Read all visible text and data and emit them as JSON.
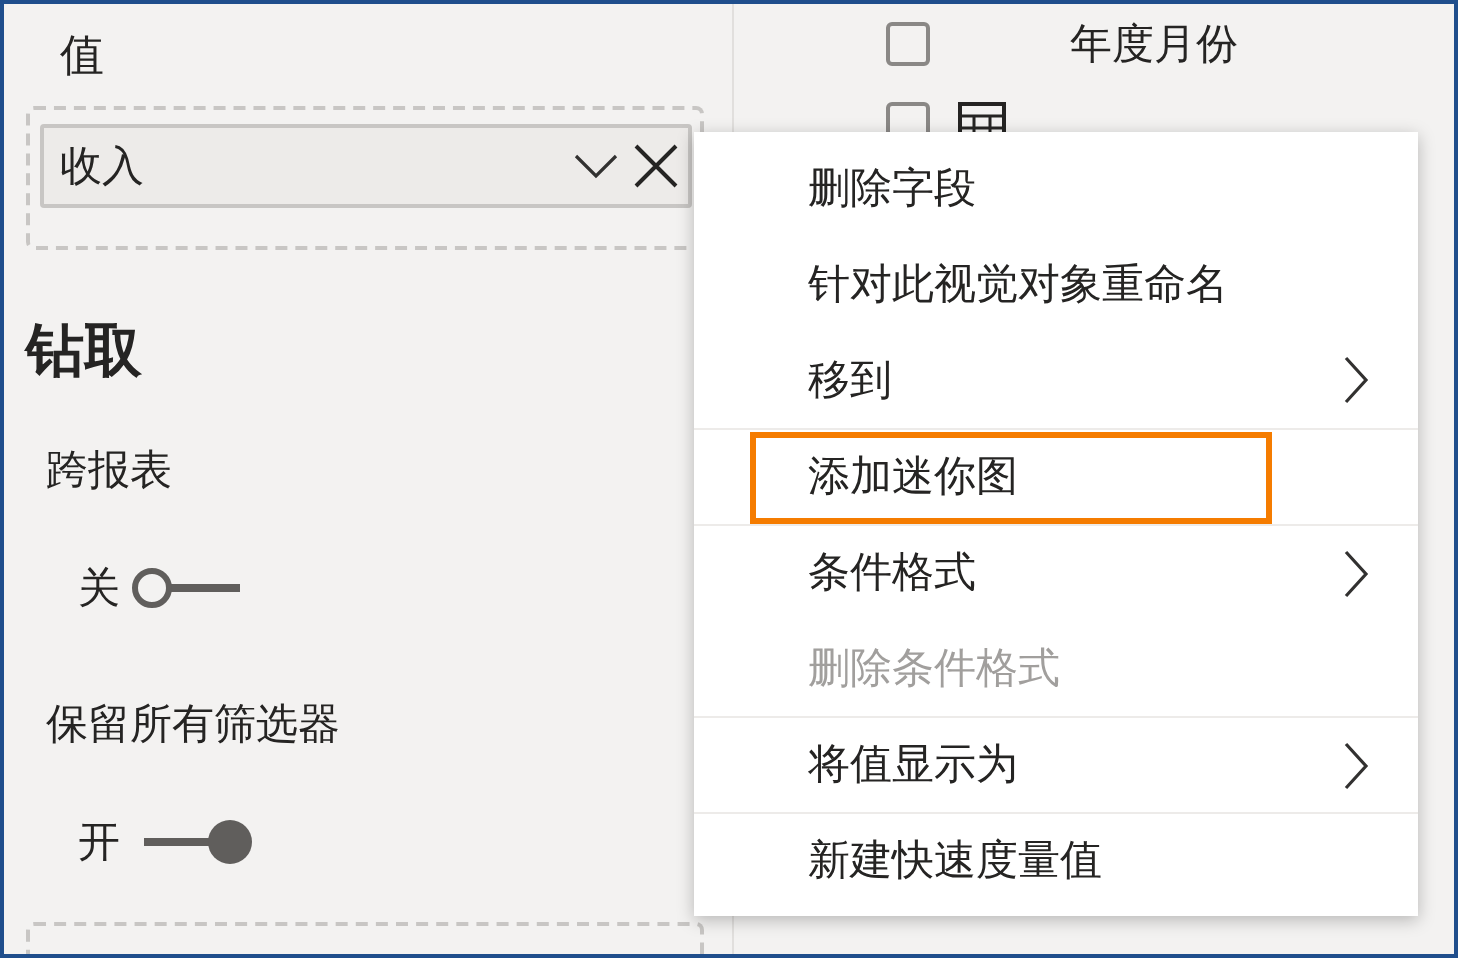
{
  "values_well": {
    "heading": "值",
    "field": {
      "label": "收入"
    }
  },
  "drillthrough": {
    "heading": "钻取",
    "toggles": [
      {
        "label": "跨报表",
        "state_text": "关",
        "on": false
      },
      {
        "label": "保留所有筛选器",
        "state_text": "开",
        "on": true
      }
    ]
  },
  "field_list": [
    {
      "label": "年度月份",
      "checked": false,
      "kind": "column"
    },
    {
      "checked": false,
      "kind": "measure"
    }
  ],
  "context_menu": [
    {
      "label": "删除字段",
      "submenu": false,
      "disabled": false,
      "highlighted": false
    },
    {
      "label": "针对此视觉对象重命名",
      "submenu": false,
      "disabled": false,
      "highlighted": false
    },
    {
      "label": "移到",
      "submenu": true,
      "disabled": false,
      "highlighted": false
    },
    {
      "label": "添加迷你图",
      "submenu": false,
      "disabled": false,
      "highlighted": true
    },
    {
      "label": "条件格式",
      "submenu": true,
      "disabled": false,
      "highlighted": false
    },
    {
      "label": "删除条件格式",
      "submenu": false,
      "disabled": true,
      "highlighted": false
    },
    {
      "label": "将值显示为",
      "submenu": true,
      "disabled": false,
      "highlighted": false
    },
    {
      "label": "新建快速度量值",
      "submenu": false,
      "disabled": false,
      "highlighted": false
    }
  ]
}
